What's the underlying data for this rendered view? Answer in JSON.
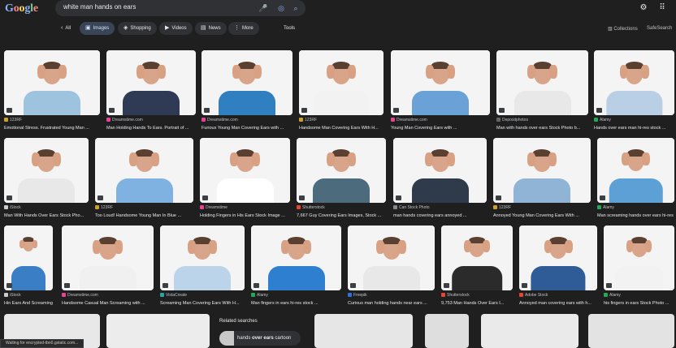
{
  "header": {
    "logo": "Google",
    "search_value": "white man hands on ears",
    "icons": [
      "mic-icon",
      "lens-icon",
      "search-icon",
      "settings-icon",
      "apps-grid-icon"
    ]
  },
  "tabs": {
    "all": "All",
    "images": "Images",
    "shopping": "Shopping",
    "videos": "Videos",
    "news": "News",
    "more": "More",
    "tools": "Tools",
    "collections": "Collections",
    "safesearch": "SafeSearch"
  },
  "results": [
    {
      "source": "123RF",
      "caption": "Emotional Stress. Frustrated Young Man ...",
      "fav": "#c9a227",
      "shirt": "#9ec3df"
    },
    {
      "source": "Dreamstime.com",
      "caption": "Man Holding Hands To Ears. Portrait of ...",
      "fav": "#e84393",
      "shirt": "#2f3b55"
    },
    {
      "source": "Dreamstime.com",
      "caption": "Furious Young Man Covering Ears with ...",
      "fav": "#e84393",
      "shirt": "#2f7fc1"
    },
    {
      "source": "123RF",
      "caption": "Handsome Man Covering Ears With H...",
      "fav": "#c9a227",
      "shirt": "#f2f2f2"
    },
    {
      "source": "Dreamstime.com",
      "caption": "Young Man Covering Ears with ...",
      "fav": "#e84393",
      "shirt": "#6aa2d8"
    },
    {
      "source": "Depositphotos",
      "caption": "Man with hands over ears Stock Photo b...",
      "fav": "#666666",
      "shirt": "#e8e8e8"
    },
    {
      "source": "Alamy",
      "caption": "Hands over ears man hi-res stock ...",
      "fav": "#22aa55",
      "shirt": "#b9cfe6"
    },
    {
      "source": "iStock",
      "caption": "Man With Hands Over Ears Stock Pho...",
      "fav": "#cccccc",
      "shirt": "#e8e8e8"
    },
    {
      "source": "123RF",
      "caption": "Too Loud! Handsome Young Man In Blue ...",
      "fav": "#c9a227",
      "shirt": "#7fb2e0"
    },
    {
      "source": "Dreamstime",
      "caption": "Holding Fingers in His Ears Stock Image ...",
      "fav": "#e84393",
      "shirt": "#ffffff"
    },
    {
      "source": "Shutterstock",
      "caption": "7,667 Guy Covering Ears Images, Stock ...",
      "fav": "#e8452c",
      "shirt": "#4c6b7c"
    },
    {
      "source": "Can Stock Photo",
      "caption": "man hands covering ears annoyed ...",
      "fav": "#888888",
      "shirt": "#2f3a4a"
    },
    {
      "source": "123RF",
      "caption": "Annoyed Young Man Covering Ears With ...",
      "fav": "#c9a227",
      "shirt": "#8fb4d6"
    },
    {
      "source": "Alamy",
      "caption": "Man screaming hands over ears hi-res ...",
      "fav": "#22aa55",
      "shirt": "#5da0d6"
    },
    {
      "source": "iStock",
      "caption": "Hin Ears And Screaming...",
      "fav": "#cccccc",
      "shirt": "#3a7fc6"
    },
    {
      "source": "Dreamstime.com",
      "caption": "Handsome Casual Man Screaming with ...",
      "fav": "#e84393",
      "shirt": "#f0f0f0"
    },
    {
      "source": "VistaCreate",
      "caption": "Screaming Man Covering Ears With H...",
      "fav": "#2aa4a6",
      "shirt": "#bcd4ea"
    },
    {
      "source": "Alamy",
      "caption": "Man fingers in ears hi-res stock ...",
      "fav": "#22aa55",
      "shirt": "#2f7fd0"
    },
    {
      "source": "Freepik",
      "caption": "Curious man holding hands near ears ...",
      "fav": "#2f6fe0",
      "shirt": "#e8e8e8"
    },
    {
      "source": "Shutterstock",
      "caption": "9,753 Man Hands Over Ears I...",
      "fav": "#e8452c",
      "shirt": "#2b2b2b"
    },
    {
      "source": "Adobe Stock",
      "caption": "Annoyed man covering ears with h...",
      "fav": "#e8452c",
      "shirt": "#2f5b96"
    },
    {
      "source": "Alamy",
      "caption": "his fingers in ears Stock Photo ...",
      "fav": "#22aa55",
      "shirt": "#f2f2f2"
    }
  ],
  "related": {
    "title": "Related searches",
    "item_prefix": "hands ",
    "item_bold": "over ears",
    "item_suffix": " cartoon"
  },
  "status_bar": "Waiting for encrypted-tbn0.gstatic.com..."
}
